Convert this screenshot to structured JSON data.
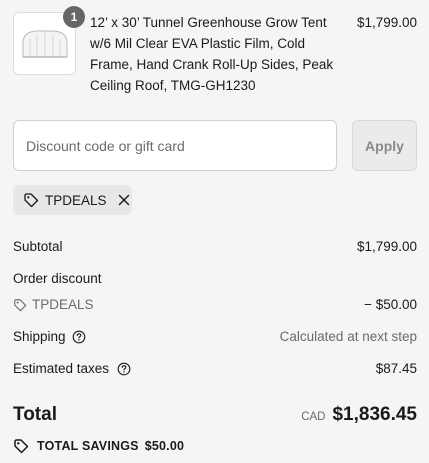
{
  "product": {
    "quantity": "1",
    "title": "12’ x 30’ Tunnel Greenhouse Grow Tent w/6 Mil Clear EVA Plastic Film, Cold Frame, Hand Crank Roll-Up Sides, Peak Ceiling Roof, TMG-GH1230",
    "price": "$1,799.00",
    "thumbnail_icon": "greenhouse-thumbnail"
  },
  "discount": {
    "placeholder": "Discount code or gift card",
    "value": "",
    "apply_label": "Apply"
  },
  "applied_code": {
    "code": "TPDEALS",
    "icon": "tag-icon",
    "remove_icon": "close-icon"
  },
  "summary": {
    "subtotal_label": "Subtotal",
    "subtotal_value": "$1,799.00",
    "order_discount_label": "Order discount",
    "discount_code": "TPDEALS",
    "discount_value": "− $50.00",
    "shipping_label": "Shipping",
    "shipping_value": "Calculated at next step",
    "taxes_label": "Estimated taxes",
    "taxes_value": "$87.45",
    "total_label": "Total",
    "currency": "CAD",
    "total_value": "$1,836.45",
    "savings_label": "TOTAL SAVINGS",
    "savings_value": "$50.00"
  },
  "colors": {
    "background": "#f5f5f5",
    "text": "#1a1a1a",
    "muted": "#6b6b6b",
    "badge": "#666666"
  }
}
